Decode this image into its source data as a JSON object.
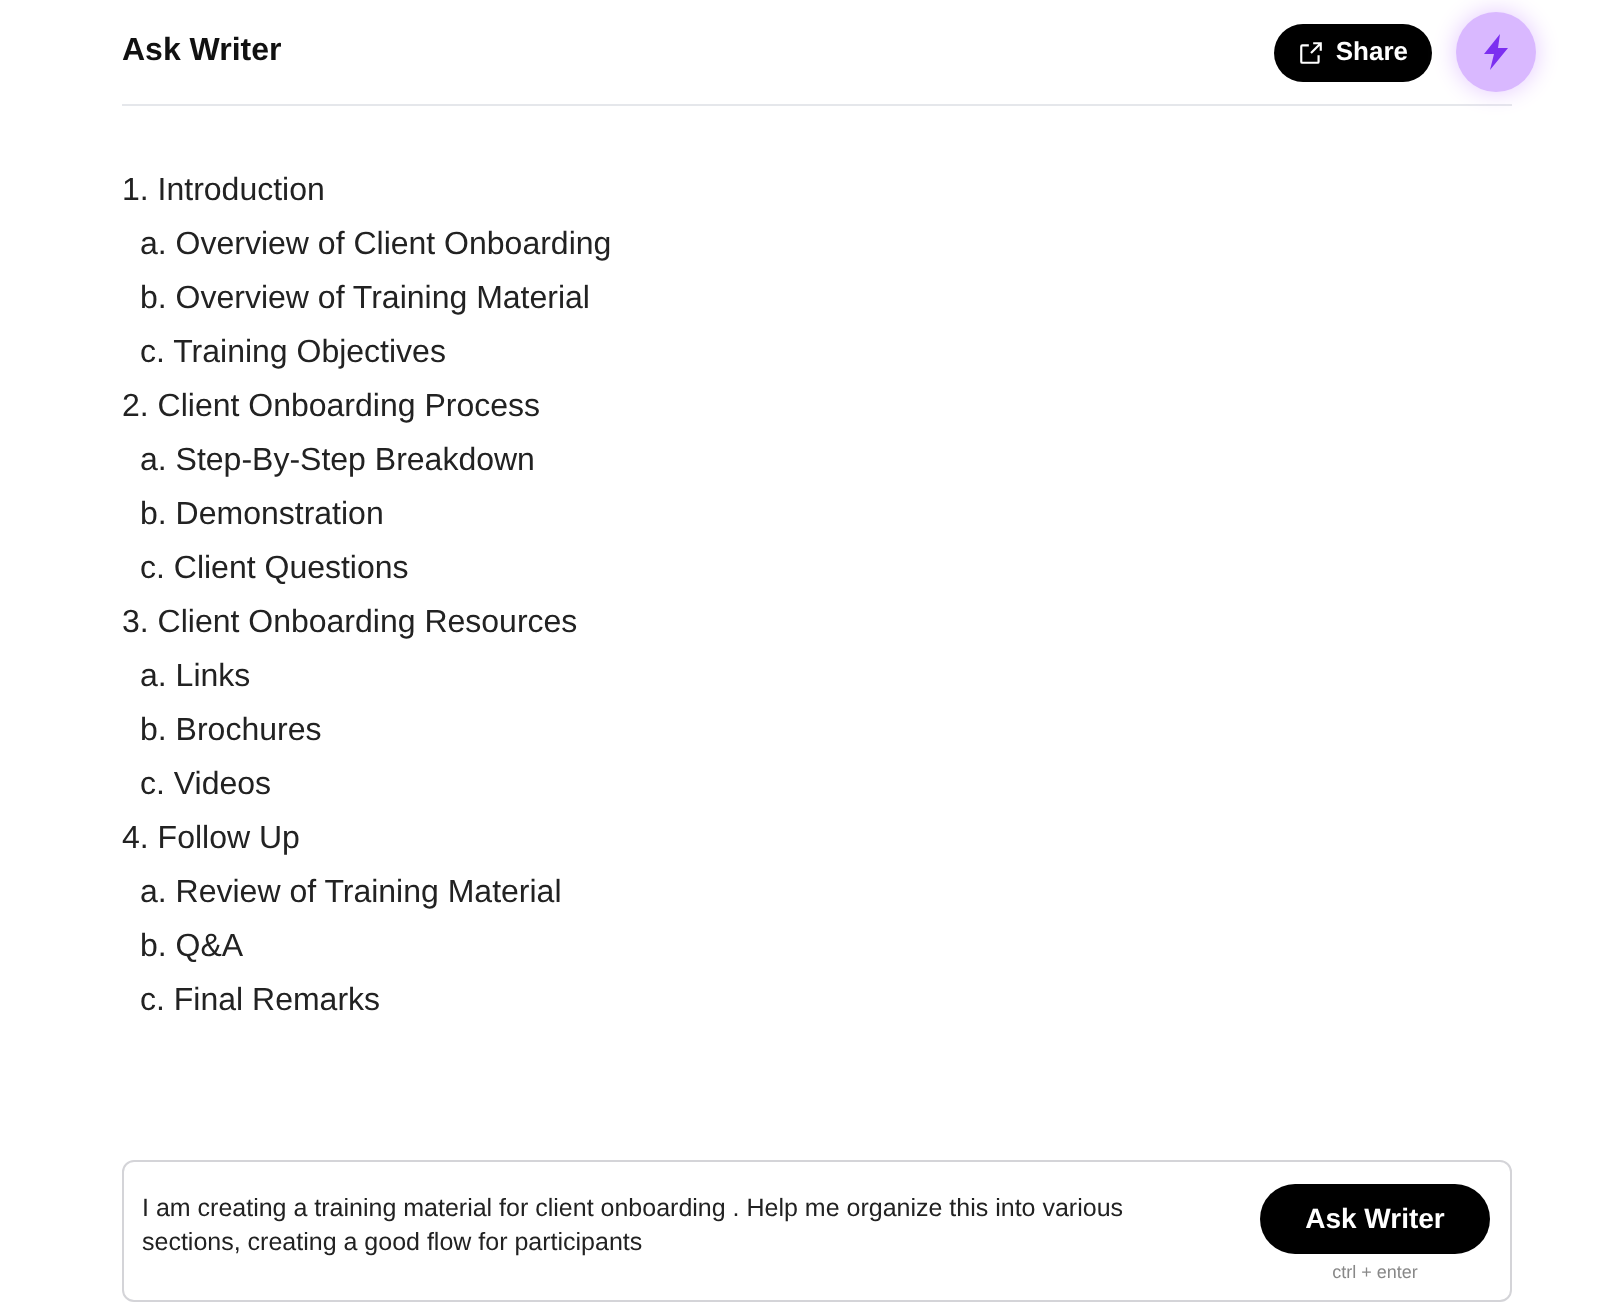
{
  "header": {
    "title": "Ask Writer",
    "share_button": "Share"
  },
  "outline": [
    {
      "label": "1. Introduction",
      "children": [
        {
          "label": "a. Overview of Client Onboarding"
        },
        {
          "label": "b. Overview of Training Material"
        },
        {
          "label": "c. Training Objectives"
        }
      ]
    },
    {
      "label": "2. Client Onboarding Process",
      "children": [
        {
          "label": "a. Step-By-Step Breakdown"
        },
        {
          "label": "b. Demonstration"
        },
        {
          "label": "c. Client Questions"
        }
      ]
    },
    {
      "label": "3. Client Onboarding Resources",
      "children": [
        {
          "label": "a. Links"
        },
        {
          "label": "b. Brochures"
        },
        {
          "label": "c. Videos"
        }
      ]
    },
    {
      "label": "4. Follow Up",
      "children": [
        {
          "label": "a. Review of Training Material"
        },
        {
          "label": "b. Q&A"
        },
        {
          "label": "c. Final Remarks"
        }
      ]
    }
  ],
  "prompt": {
    "value": "I am creating a training material for client onboarding . Help me organize this into various sections, creating a good flow for participants",
    "button": "Ask Writer",
    "shortcut": "ctrl + enter"
  }
}
